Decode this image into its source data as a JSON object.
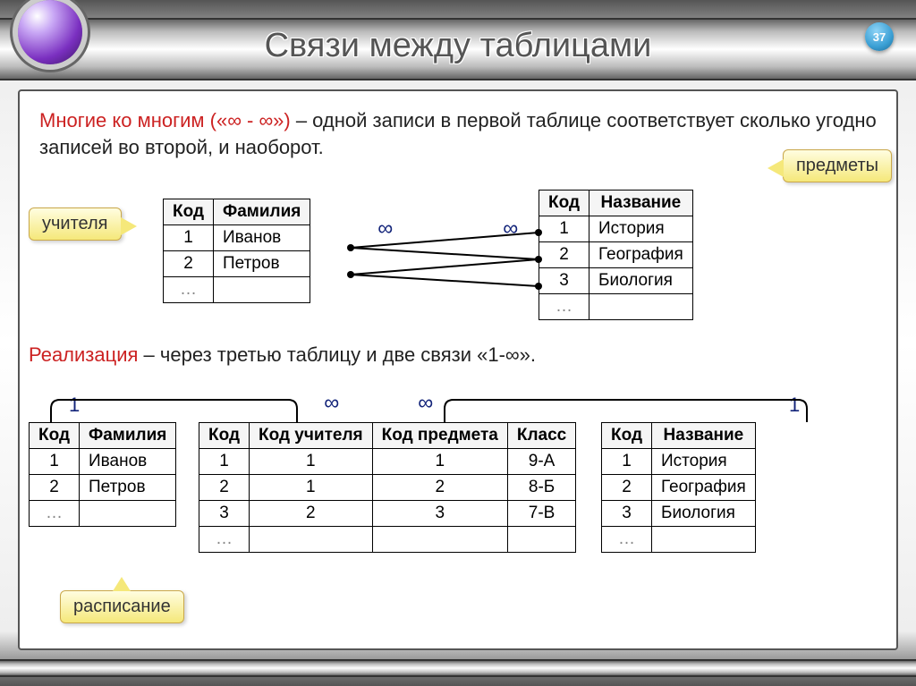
{
  "page_number": "37",
  "title": "Связи между таблицами",
  "intro_prefix": "Многие ко многим («∞ - ∞»)",
  "intro_rest": " – одной записи в первой таблице соответствует сколько угодно записей во второй, и наоборот.",
  "realization_prefix": "Реализация",
  "realization_rest": " – через третью таблицу и две связи «1-∞».",
  "callouts": {
    "teachers": "учителя",
    "subjects": "предметы",
    "schedule": "расписание"
  },
  "symbols": {
    "infinity": "∞",
    "one": "1"
  },
  "table_teachers": {
    "headers": [
      "Код",
      "Фамилия"
    ],
    "rows": [
      [
        "1",
        "Иванов"
      ],
      [
        "2",
        "Петров"
      ],
      [
        "…",
        ""
      ]
    ]
  },
  "table_subjects": {
    "headers": [
      "Код",
      "Название"
    ],
    "rows": [
      [
        "1",
        "История"
      ],
      [
        "2",
        "География"
      ],
      [
        "3",
        "Биология"
      ],
      [
        "…",
        ""
      ]
    ]
  },
  "table_teachers2": {
    "headers": [
      "Код",
      "Фамилия"
    ],
    "rows": [
      [
        "1",
        "Иванов"
      ],
      [
        "2",
        "Петров"
      ],
      [
        "…",
        ""
      ]
    ]
  },
  "table_schedule": {
    "headers": [
      "Код",
      "Код учителя",
      "Код предмета",
      "Класс"
    ],
    "rows": [
      [
        "1",
        "1",
        "1",
        "9-А"
      ],
      [
        "2",
        "1",
        "2",
        "8-Б"
      ],
      [
        "3",
        "2",
        "3",
        "7-В"
      ],
      [
        "…",
        "",
        "",
        ""
      ]
    ]
  },
  "table_subjects2": {
    "headers": [
      "Код",
      "Название"
    ],
    "rows": [
      [
        "1",
        "История"
      ],
      [
        "2",
        "География"
      ],
      [
        "3",
        "Биология"
      ],
      [
        "…",
        ""
      ]
    ]
  }
}
